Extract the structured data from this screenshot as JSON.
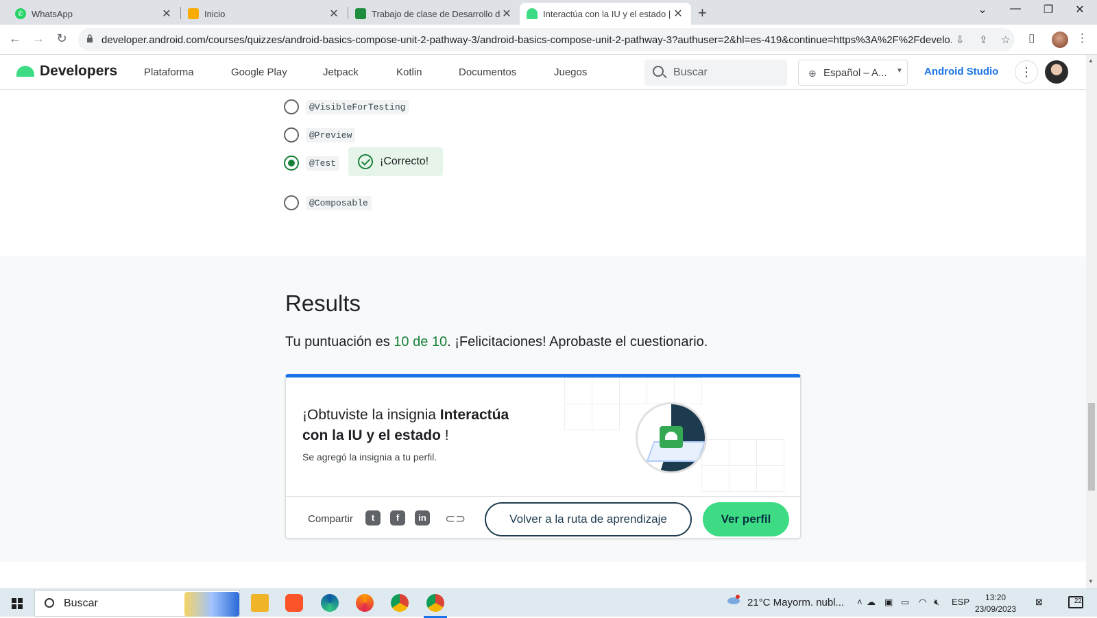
{
  "browser": {
    "tabs": [
      {
        "title": "WhatsApp",
        "icon": "whatsapp-icon",
        "color": "#25d366"
      },
      {
        "title": "Inicio",
        "icon": "classroom-icon",
        "color": "#f9ab00"
      },
      {
        "title": "Trabajo de clase de Desarrollo de",
        "icon": "classroom-icon",
        "color": "#1e8e3e"
      },
      {
        "title": "Interactúa con la IU y el estado |",
        "icon": "android-icon",
        "color": "#3ddc84"
      }
    ],
    "url": "developer.android.com/courses/quizzes/android-basics-compose-unit-2-pathway-3/android-basics-compose-unit-2-pathway-3?authuser=2&hl=es-419&continue=https%3A%2F%2Fdevelo..."
  },
  "site": {
    "logo": "Developers",
    "nav": [
      "Plataforma",
      "Google Play",
      "Jetpack",
      "Kotlin",
      "Documentos",
      "Juegos"
    ],
    "search_placeholder": "Buscar",
    "language": "Español – A...",
    "studio_link": "Android Studio"
  },
  "quiz": {
    "options": [
      {
        "code": "@VisibleForTesting",
        "selected": false
      },
      {
        "code": "@Preview",
        "selected": false
      },
      {
        "code": "@Test",
        "selected": true
      },
      {
        "code": "@Composable",
        "selected": false
      }
    ],
    "feedback": "¡Correcto!"
  },
  "results": {
    "title": "Results",
    "score_prefix": "Tu puntuación es ",
    "score_value": "10 de 10",
    "score_suffix": ". ¡Felicitaciones! Aprobaste el cuestionario.",
    "badge_prefix": "¡Obtuviste la insignia ",
    "badge_name": "Interactúa con la IU y el estado",
    "badge_suffix": " !",
    "badge_sub": "Se agregó la insignia a tu perfil.",
    "share_label": "Compartir",
    "share_icons": [
      "twitter-icon",
      "facebook-icon",
      "linkedin-icon",
      "link-icon"
    ],
    "back_button": "Volver a la ruta de aprendizaje",
    "profile_button": "Ver perfil"
  },
  "taskbar": {
    "search_placeholder": "Buscar",
    "weather": "21°C  Mayorm. nubl...",
    "weather_badge": "1",
    "lang": "ESP",
    "time": "13:20",
    "date": "23/09/2023",
    "notifications": "22"
  }
}
